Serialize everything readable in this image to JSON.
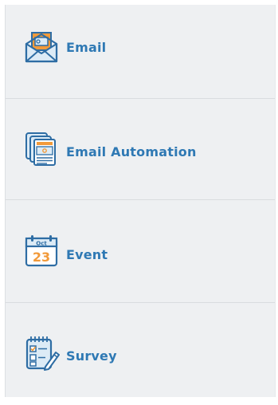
{
  "menu": {
    "items": [
      {
        "label": "Email",
        "icon": "email-envelope-icon"
      },
      {
        "label": "Email Automation",
        "icon": "email-automation-icon"
      },
      {
        "label": "Event",
        "icon": "event-calendar-icon",
        "calendar_month": "Oct",
        "calendar_day": "23"
      },
      {
        "label": "Survey",
        "icon": "survey-clipboard-icon"
      }
    ]
  },
  "colors": {
    "label": "#2f79b4",
    "icon_stroke": "#2e6da4",
    "icon_fill_light": "#dcebf6",
    "icon_accent": "#f29a3a",
    "panel_bg": "#eef0f2"
  }
}
